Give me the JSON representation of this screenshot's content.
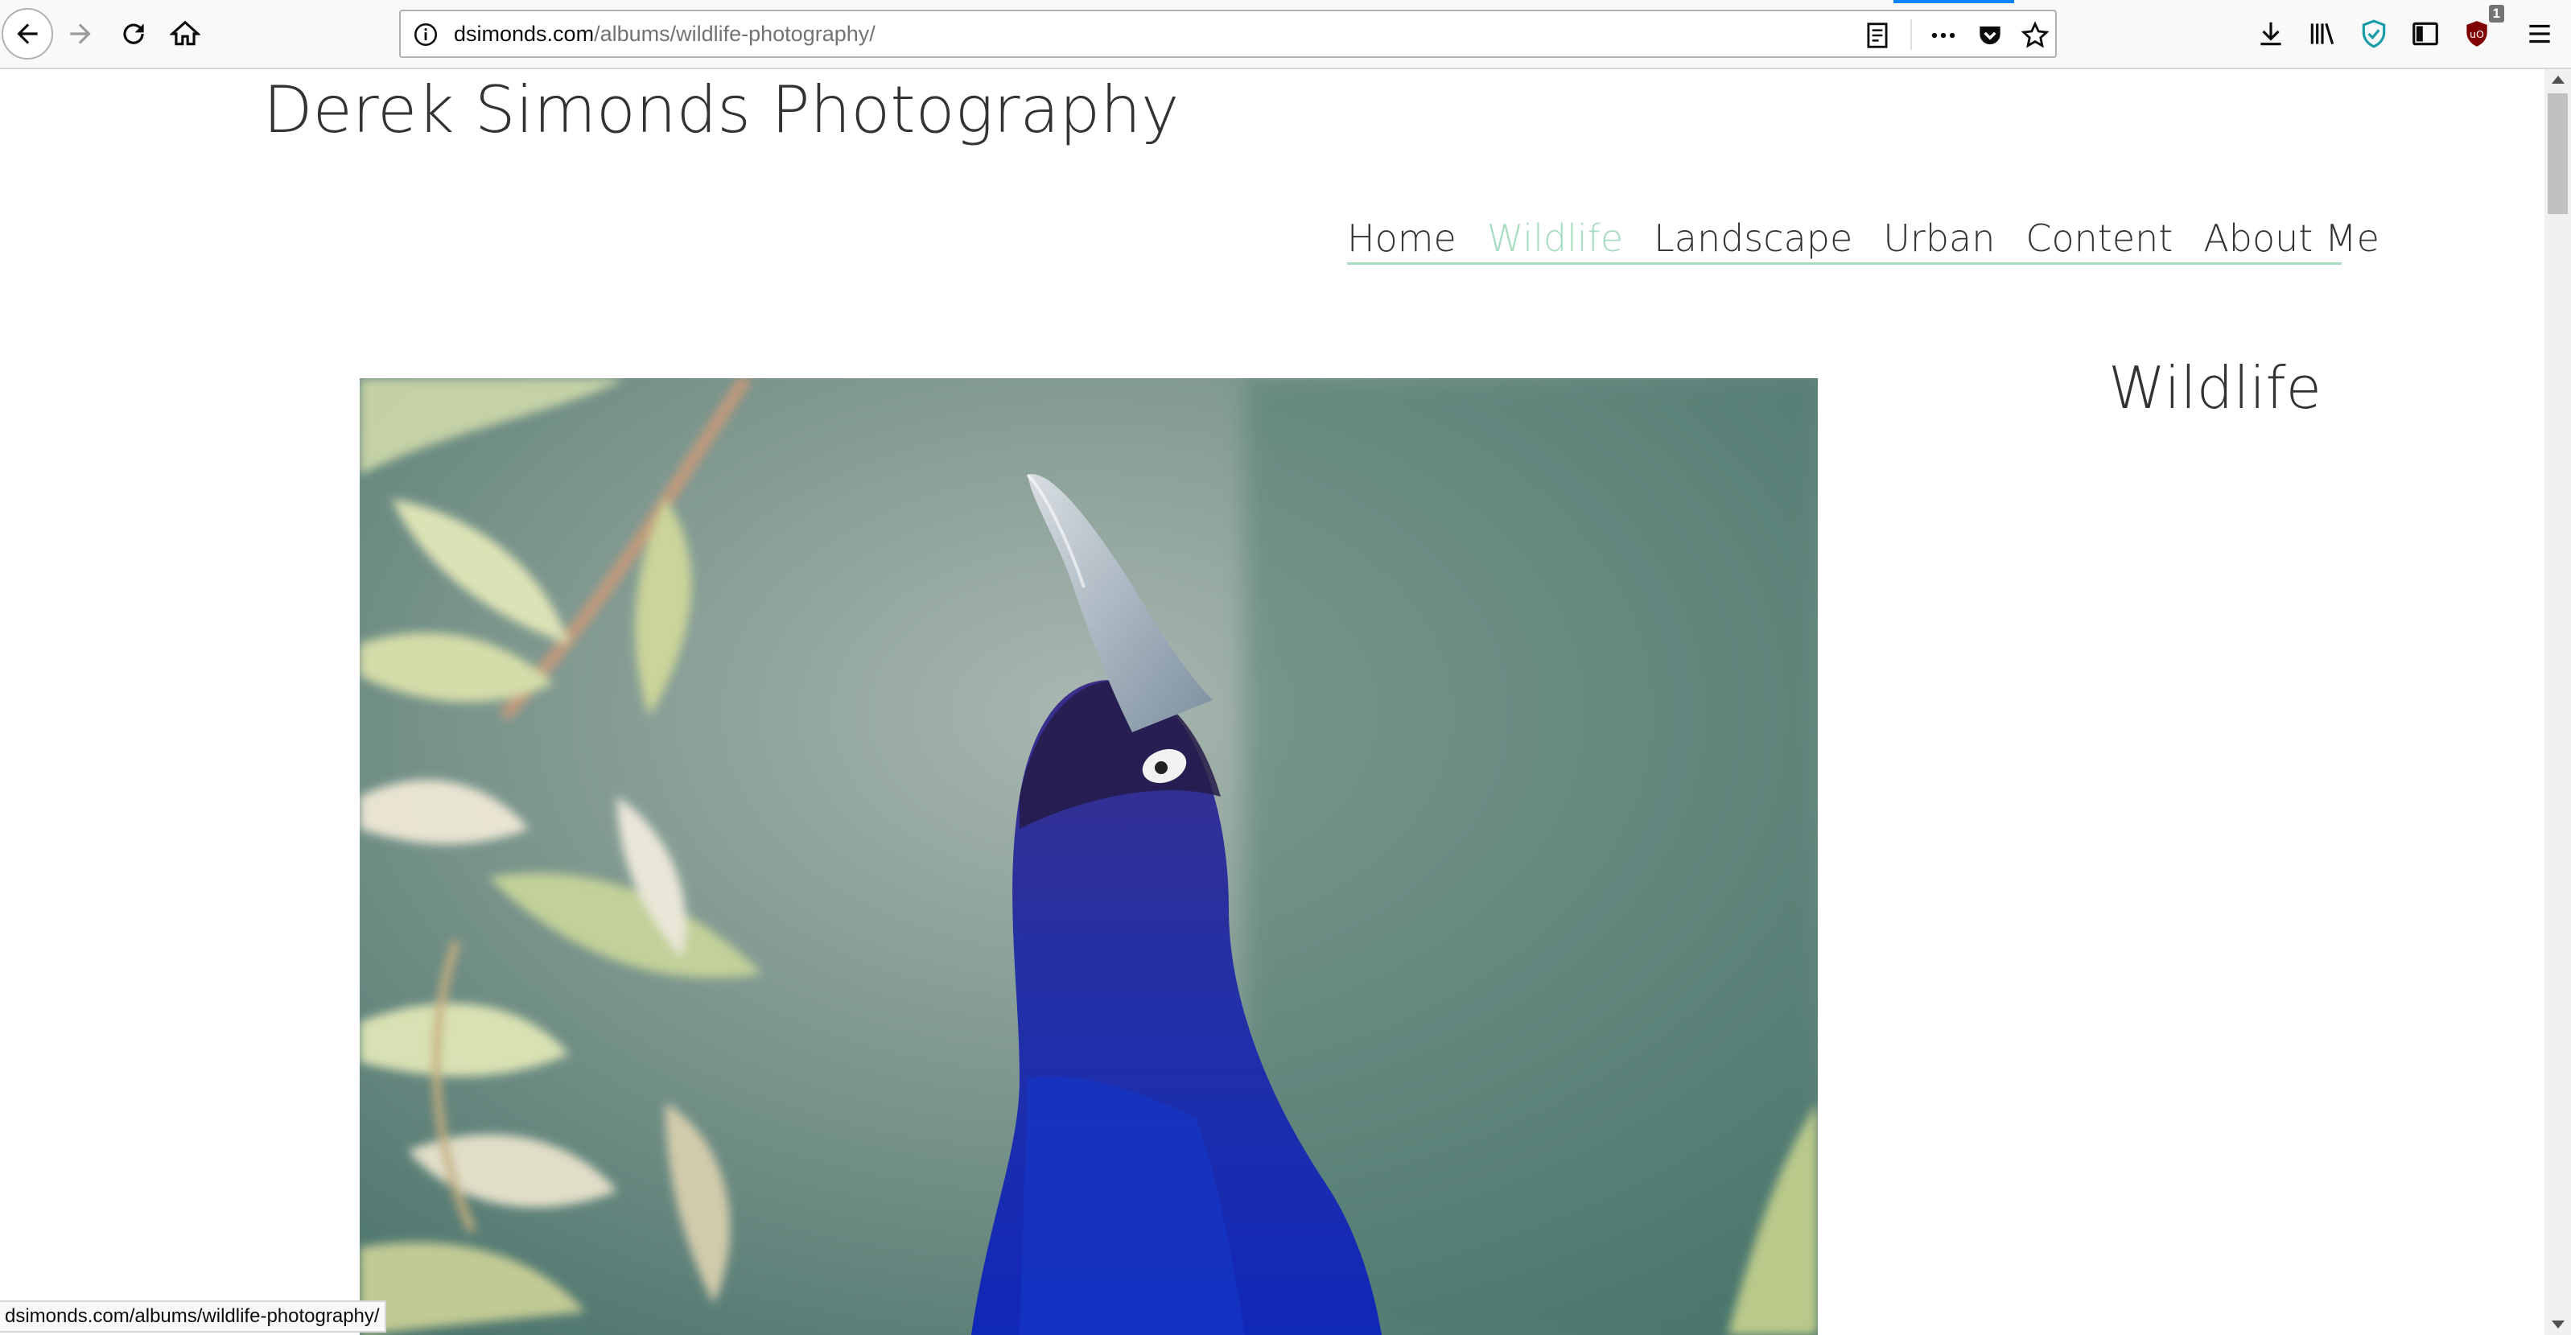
{
  "browser": {
    "url_host": "dsimonds.com",
    "url_path": "/albums/wildlife-photography/",
    "status_url": "dsimonds.com/albums/wildlife-photography/",
    "extension_badge": "1",
    "accent_color": "#0a84ff"
  },
  "site": {
    "title": "Derek Simonds Photography",
    "nav": [
      {
        "label": "Home",
        "active": false
      },
      {
        "label": "Wildlife",
        "active": true
      },
      {
        "label": "Landscape",
        "active": false
      },
      {
        "label": "Urban",
        "active": false
      },
      {
        "label": "Content",
        "active": false
      },
      {
        "label": "About Me",
        "active": false
      }
    ],
    "nav_accent_color": "#a8dcc0",
    "page_heading": "Wildlife"
  },
  "icons": {
    "back": "back-arrow-icon",
    "forward": "forward-arrow-icon",
    "reload": "reload-icon",
    "home": "home-icon",
    "info": "info-icon",
    "reader": "reader-view-icon",
    "more": "more-actions-icon",
    "pocket": "pocket-icon",
    "bookmark": "star-icon",
    "downloads": "download-icon",
    "library": "library-icon",
    "extension_shield": "shield-icon",
    "sidebar": "sidebar-icon",
    "ublock": "ublock-icon",
    "menu": "hamburger-menu-icon"
  }
}
